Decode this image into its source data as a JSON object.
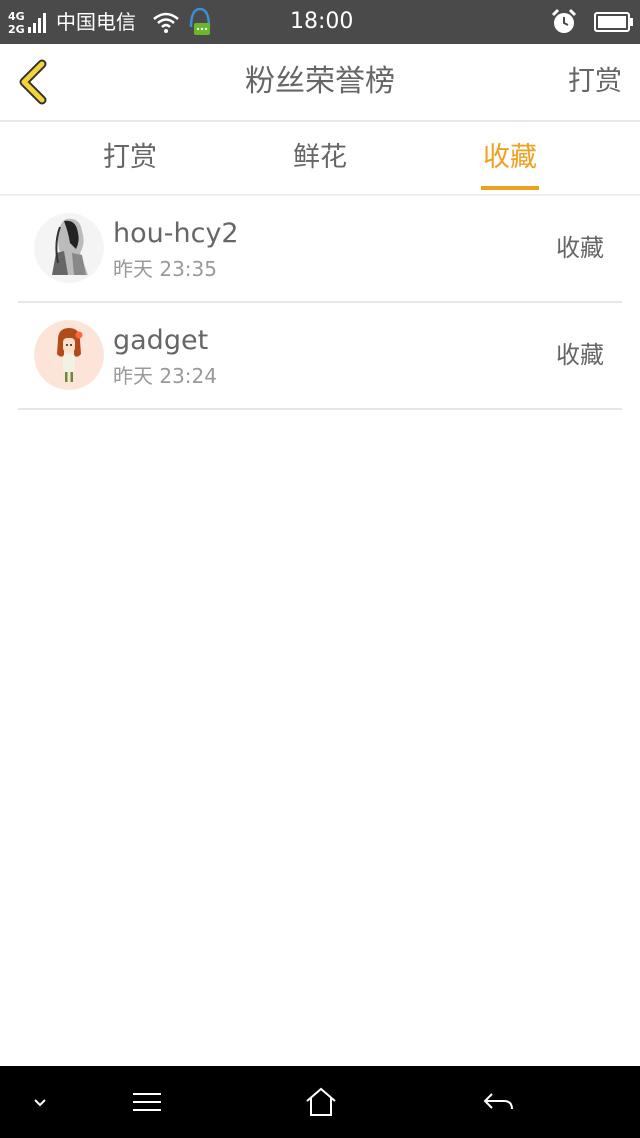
{
  "status_bar": {
    "network": "4G 2G",
    "carrier": "中国电信",
    "time": "18:00",
    "icons": [
      "signal-icon",
      "wifi-icon",
      "app-notification-icon",
      "alarm-icon",
      "battery-icon"
    ]
  },
  "header": {
    "title": "粉丝荣誉榜",
    "back_icon": "chevron-left-icon",
    "right_label": "打赏"
  },
  "tabs": [
    {
      "label": "打赏",
      "active": false
    },
    {
      "label": "鲜花",
      "active": false
    },
    {
      "label": "收藏",
      "active": true
    }
  ],
  "list": [
    {
      "name": "hou-hcy2",
      "time": "昨天 23:35",
      "action": "收藏",
      "avatar": "sketch-girl-avatar"
    },
    {
      "name": "gadget",
      "time": "昨天 23:24",
      "action": "收藏",
      "avatar": "cartoon-girl-avatar"
    }
  ],
  "nav_bar": {
    "icons": [
      "chevron-down-icon",
      "menu-icon",
      "home-icon",
      "back-arrow-icon"
    ]
  },
  "colors": {
    "accent": "#f0a020",
    "status_bar_bg": "#4a4a4a",
    "nav_bar_bg": "#000000",
    "text_primary": "#666666",
    "text_secondary": "#999999"
  }
}
